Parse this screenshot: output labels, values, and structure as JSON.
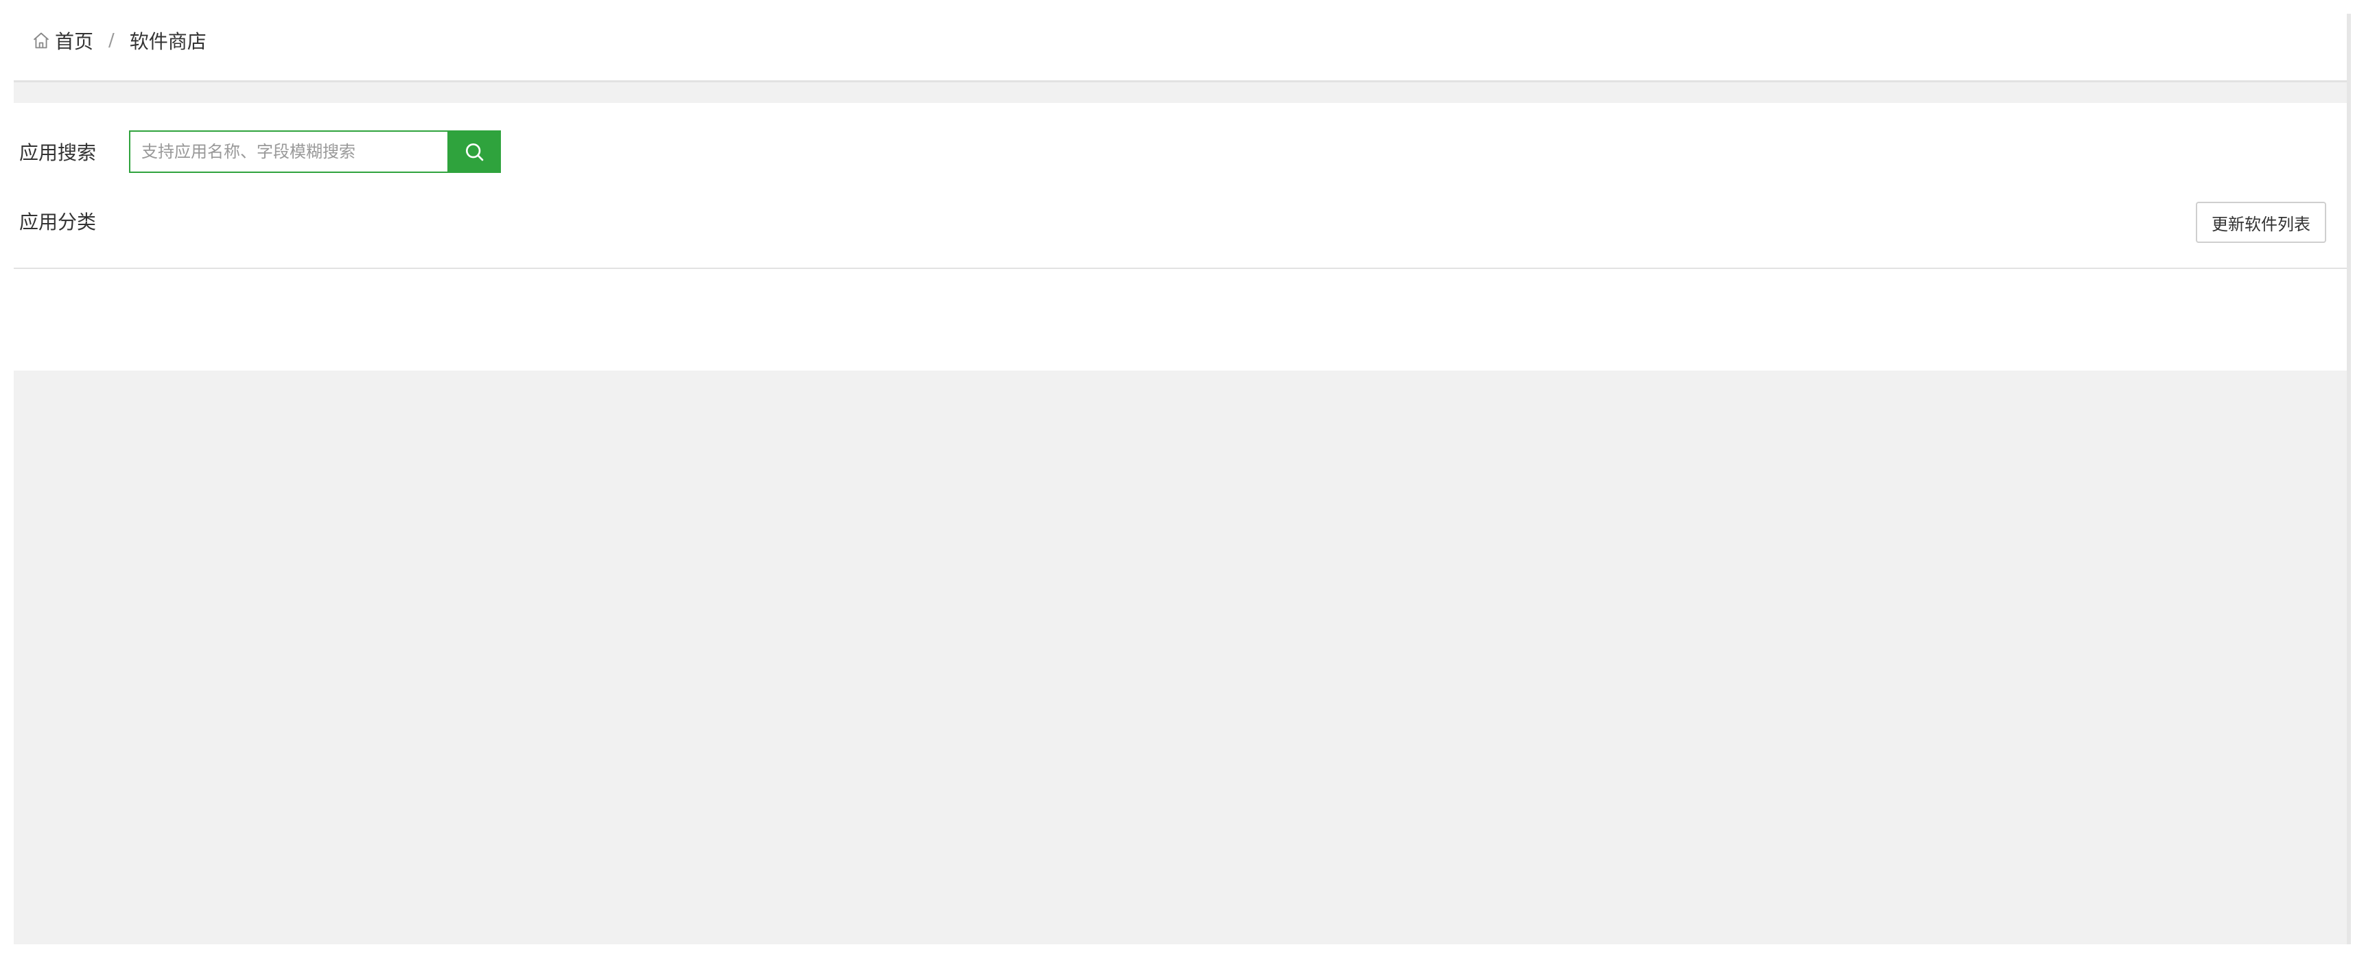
{
  "breadcrumb": {
    "home_icon": "home-icon",
    "home_label": "首页",
    "separator": "/",
    "current": "软件商店"
  },
  "search": {
    "label": "应用搜索",
    "placeholder": "支持应用名称、字段模糊搜索",
    "value": "",
    "button_icon": "search-icon"
  },
  "category": {
    "label": "应用分类"
  },
  "toolbar": {
    "update_label": "更新软件列表"
  },
  "colors": {
    "accent": "#2fa33d",
    "background": "#f1f1f1",
    "panel": "#ffffff",
    "border": "#e2e2e2"
  }
}
